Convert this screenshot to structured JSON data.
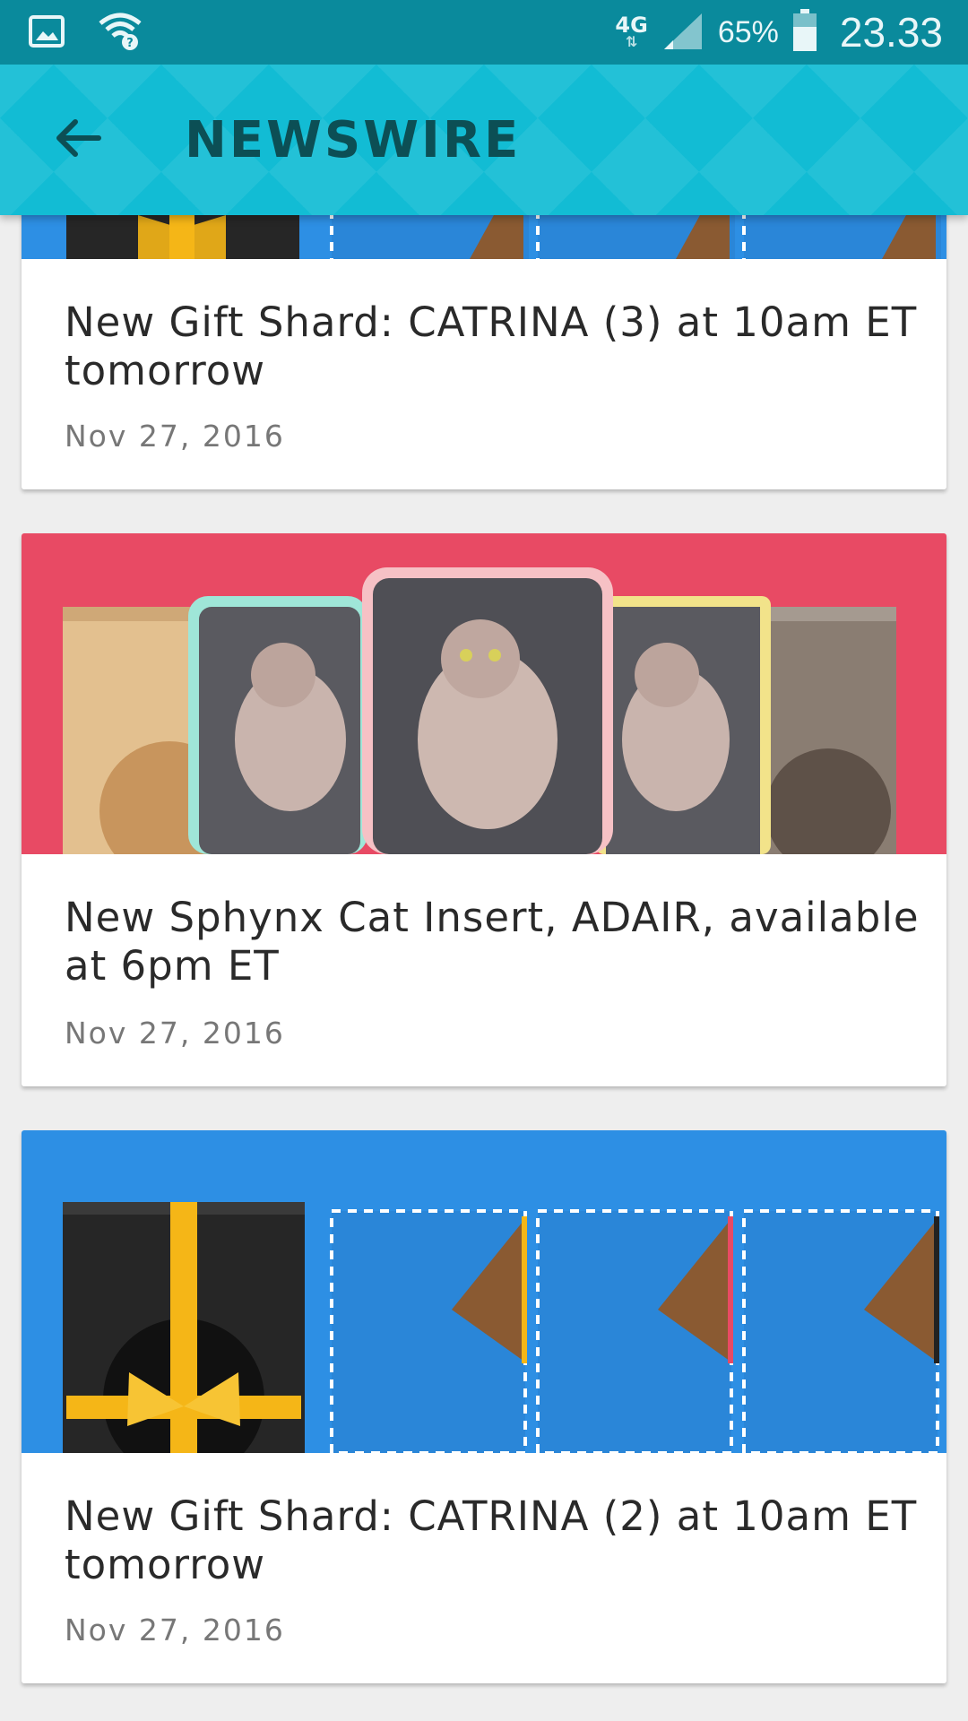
{
  "status_bar": {
    "network": "4G",
    "battery": "65%",
    "time": "23.33",
    "icons": [
      "image-icon",
      "wifi-icon",
      "signal-icon",
      "battery-icon"
    ]
  },
  "app_bar": {
    "title": "NEWSWIRE",
    "back_icon": "arrow-left-icon"
  },
  "news": [
    {
      "title": "New Gift Shard: CATRINA (3) at 10am ET tomorrow",
      "date": "Nov 27, 2016",
      "image": "gift-shard-banner"
    },
    {
      "title": "New Sphynx Cat Insert, ADAIR, available at 6pm ET",
      "date": "Nov 27, 2016",
      "image": "sphynx-cat-banner"
    },
    {
      "title": "New Gift Shard: CATRINA (2) at 10am ET tomorrow",
      "date": "Nov 27, 2016",
      "image": "gift-shard-banner"
    }
  ],
  "colors": {
    "status_bar": "#0a8a9c",
    "app_bar": "#12bcd4",
    "title_text": "#0c4f55",
    "gift_banner": "#2d8fe4",
    "cat_banner": "#e84a64"
  }
}
